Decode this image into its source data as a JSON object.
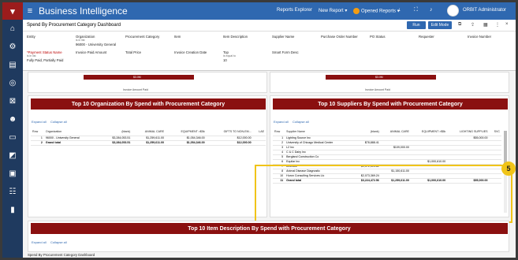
{
  "app": {
    "title": "Business Intelligence"
  },
  "topnav": {
    "reports_explorer": "Reports Explorer",
    "new_report": "New Report ▾",
    "opened_reports": "Opened Reports ▾",
    "user": "ORBIT Administrator"
  },
  "dashboard": {
    "title": "Spend By Procurement Category Dashboard",
    "run": "Run",
    "edit_mode": "Edit Mode",
    "footer": "Spend By Procurement Category Dashboard"
  },
  "filters": {
    "entity": "Entity",
    "organization": "Organization",
    "org_op": "is in list",
    "org_value": "96000 - University General",
    "procurement_category": "Procurement Category",
    "item": "Item",
    "item_description": "Item Description",
    "supplier_name": "Supplier Name",
    "purchase_order_number": "Purchase Order Number",
    "po_status": "PO Status",
    "requester": "Requester",
    "invoice_number": "Invoice Number",
    "payment_status": "*Payment Status Name",
    "payment_op": "is in list",
    "payment_value": "Fully Paid, Partially Paid",
    "invoice_paid_amount": "Invoice Paid Amount",
    "total_price": "Total Price",
    "invoice_creation_date": "Invoice Creation Date",
    "top": "Top",
    "top_op": "is equal to",
    "top_value": "10",
    "smart_form_desc": "Smart Form Desc"
  },
  "charts": {
    "left_value": "$3.0M",
    "right_value": "$3.0M",
    "axis_label": "Invoice Amount Paid"
  },
  "org_panel": {
    "title": "Top 10 Organization By Spend with Procurement Category",
    "expand_all": "Expand all",
    "collapse_all": "Collapse all",
    "columns": [
      "Row",
      "Organization",
      "(blank)",
      "ANIMAL CARE",
      "EQUIPMENT >$5k",
      "GIFTS TO NON-EM...",
      "LAE"
    ],
    "rows": [
      [
        "1",
        "96000 - University General",
        "$3,284,053.51",
        "$1,259,611.00",
        "$1,054,346.00",
        "$12,000.00",
        ""
      ],
      [
        "2",
        "Grand total",
        "$3,284,053.51",
        "$1,259,611.00",
        "$1,054,346.00",
        "$12,000.00",
        ""
      ]
    ]
  },
  "supplier_panel": {
    "title": "Top 10 Suppliers By Spend with Procurement Category",
    "expand_all": "Expand all",
    "collapse_all": "Collapse all",
    "columns": [
      "Row",
      "Supplier Name",
      "(blank)",
      "ANIMAL CARE",
      "EQUIPMENT >$5k",
      "LIGHTING SUPPLIES",
      "SVC"
    ],
    "rows": [
      [
        "1",
        "Lighting Source Inc",
        "",
        "",
        "",
        "$55,000.00",
        ""
      ],
      [
        "2",
        "University of Chicago Medical Center",
        "$78,888.41",
        "",
        "",
        "",
        ""
      ],
      [
        "3",
        "L2 Inc",
        "",
        "$109,000.00",
        "",
        "",
        ""
      ],
      [
        "4",
        "C & C Dairy Inc",
        "",
        "",
        "",
        "",
        ""
      ],
      [
        "5",
        "Bergland Construction Co",
        "",
        "",
        "",
        "",
        ""
      ],
      [
        "6",
        "Equilar Inc",
        "",
        "",
        "$1,000,610.00",
        "",
        ""
      ],
      [
        "7",
        "Aramark",
        "$1,072,514.81",
        "",
        "",
        "",
        ""
      ],
      [
        "8",
        "Animal Disease Diagnostic",
        "",
        "$1,150,611.00",
        "",
        "",
        ""
      ],
      [
        "10",
        "Huron Consulting Services Llc",
        "$2,073,369.24",
        "",
        "",
        "",
        ""
      ],
      [
        "11",
        "Grand total",
        "$3,224,472.56",
        "$1,259,611.00",
        "$1,000,610.00",
        "$55,000.00",
        ""
      ]
    ]
  },
  "item_panel": {
    "title": "Top 10 Item Description By Spend with Procurement Category",
    "expand_all": "Expand all",
    "collapse_all": "Collapse all"
  },
  "callout": {
    "number": "5"
  }
}
